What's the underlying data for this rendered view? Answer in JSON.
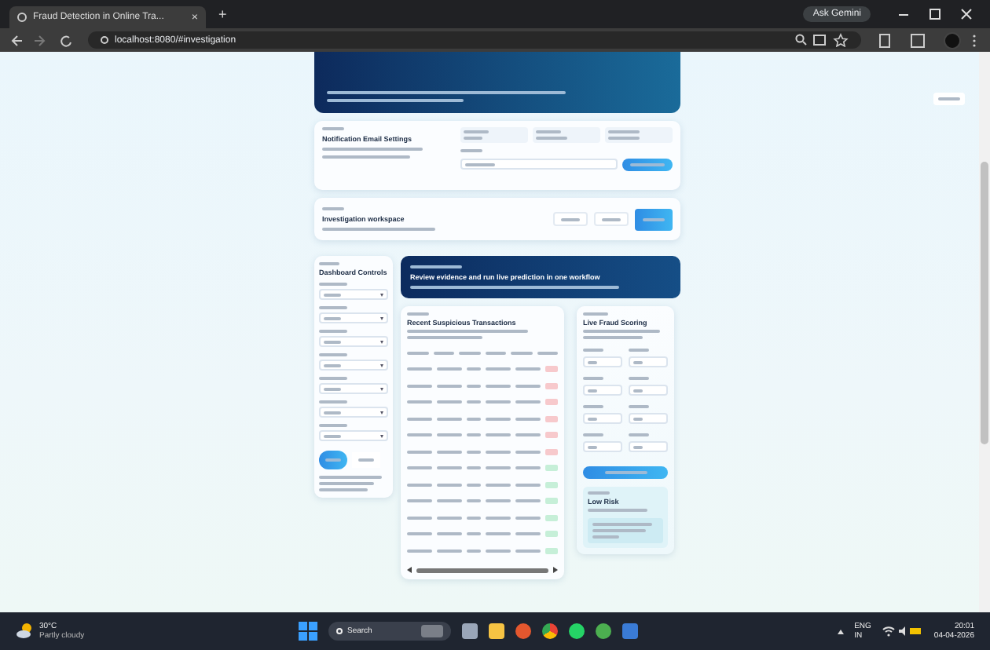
{
  "browser": {
    "tab_title": "Fraud Detection in Online Tra...",
    "tab_close": "×",
    "new_tab": "+",
    "gemini": "Ask Gemini",
    "url": "localhost:8080/#investigation"
  },
  "email_card": {
    "title": "Notification Email Settings"
  },
  "workspace": {
    "title": "Investigation workspace",
    "tabs": [
      {
        "selected": false
      },
      {
        "selected": false
      },
      {
        "selected": true
      }
    ]
  },
  "controls": {
    "title": "Dashboard Controls"
  },
  "banner": {
    "title": "Review evidence and run live prediction in one workflow"
  },
  "table": {
    "title": "Recent Suspicious Transactions",
    "rows": [
      {
        "flagged": true
      },
      {
        "flagged": true
      },
      {
        "flagged": true
      },
      {
        "flagged": true
      },
      {
        "flagged": true
      },
      {
        "flagged": true
      },
      {
        "flagged": false
      },
      {
        "flagged": false
      },
      {
        "flagged": false
      },
      {
        "flagged": false
      },
      {
        "flagged": false
      },
      {
        "flagged": false
      }
    ]
  },
  "scoring": {
    "title": "Live Fraud Scoring",
    "result": "Low Risk"
  },
  "taskbar": {
    "temperature": "30°C",
    "weather": "Partly cloudy",
    "search": "Search",
    "lang": "ENG",
    "region": "IN",
    "time": "20:01",
    "date": "04-04-2026"
  }
}
